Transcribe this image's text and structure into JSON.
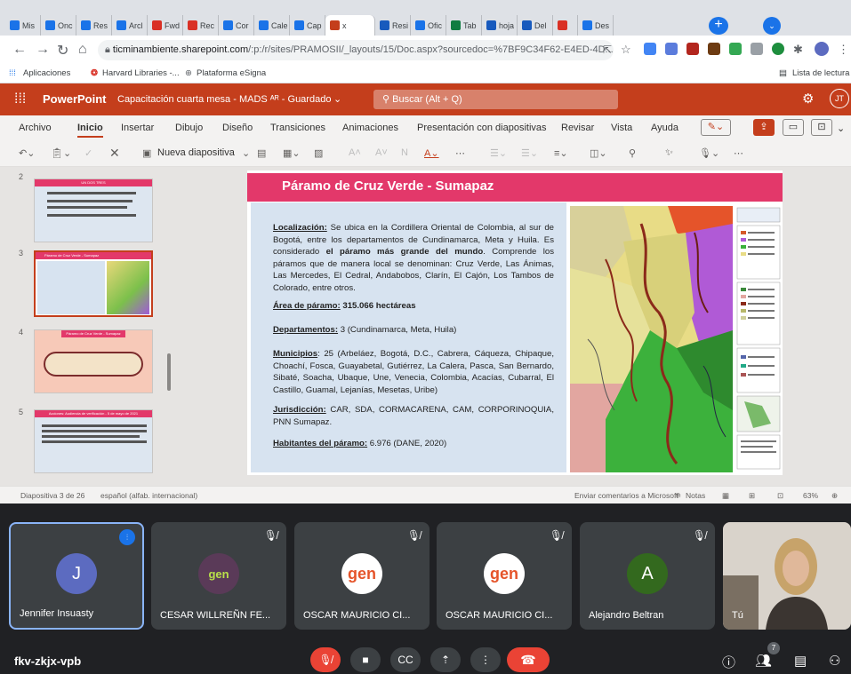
{
  "browser": {
    "tabs": [
      {
        "label": "Mis",
        "icon": "cloud-icon",
        "color": "#1a73e8"
      },
      {
        "label": "Onc",
        "icon": "cloud-icon",
        "color": "#1a73e8"
      },
      {
        "label": "Res",
        "icon": "cloud-icon",
        "color": "#1a73e8"
      },
      {
        "label": "Arcl",
        "icon": "cloud-icon",
        "color": "#1a73e8"
      },
      {
        "label": "Fwd",
        "icon": "gmail-icon",
        "color": "#d93025"
      },
      {
        "label": "Rec",
        "icon": "gmail-icon",
        "color": "#d93025"
      },
      {
        "label": "Cor",
        "icon": "docs-icon",
        "color": "#1a73e8"
      },
      {
        "label": "Cale",
        "icon": "calendar-icon",
        "color": "#1a73e8"
      },
      {
        "label": "Cap",
        "icon": "cloud-icon",
        "color": "#1a73e8"
      },
      {
        "label": "x",
        "icon": "powerpoint-icon",
        "color": "#c43e1c"
      },
      {
        "label": "Resi",
        "icon": "word-icon",
        "color": "#185abd"
      },
      {
        "label": "Ofic",
        "icon": "cloud-icon",
        "color": "#1a73e8"
      },
      {
        "label": "Tab",
        "icon": "excel-icon",
        "color": "#107c41"
      },
      {
        "label": "hoja",
        "icon": "word-icon",
        "color": "#185abd"
      },
      {
        "label": "Del",
        "icon": "word-icon",
        "color": "#185abd"
      },
      {
        "label": "",
        "icon": "record-icon",
        "color": "#d93025"
      },
      {
        "label": "Des",
        "icon": "download-icon",
        "color": "#1a73e8"
      }
    ],
    "new_tab": "+",
    "url_host": "ticminambiente.sharepoint.com",
    "url_path": "/:p:/r/sites/PRAMOSII/_layouts/15/Doc.aspx?sourcedoc=%7BF9C34F62-E4ED-4D...",
    "bookmarks": [
      "Aplicaciones",
      "Harvard Libraries -...",
      "Plataforma eSigna"
    ],
    "reading_list": "Lista de lectura"
  },
  "ppt": {
    "app_name": "PowerPoint",
    "doc_title": "Capacitación cuarta mesa - MADS  ᴬᴿ - Guardado",
    "search_placeholder": "Buscar (Alt + Q)",
    "user_initials": "JT",
    "menu_tabs": [
      "Archivo",
      "Inicio",
      "Insertar",
      "Dibujo",
      "Diseño",
      "Transiciones",
      "Animaciones",
      "Presentación con diapositivas",
      "Revisar",
      "Vista",
      "Ayuda"
    ],
    "active_menu": "Inicio",
    "new_slide": "Nueva diapositiva",
    "thumbnails": [
      {
        "num": "2",
        "title": "UN DOS TRES"
      },
      {
        "num": "3",
        "title": "Páramo de Cruz Verde - Sumapaz"
      },
      {
        "num": "4",
        "title": "Páramo de Cruz Verde - Sumapaz"
      },
      {
        "num": "5",
        "title": "Acciones: Audiencia de verificación - 5 de mayo de 2021"
      }
    ],
    "status": {
      "slide_info": "Diapositiva 3 de 26",
      "language": "español (alfab. internacional)",
      "feedback": "Enviar comentarios a Microsoft",
      "notes": "Notas",
      "zoom": "63%"
    }
  },
  "slide": {
    "title": "Páramo de Cruz Verde - Sumapaz",
    "localizacion_label": "Localización:",
    "localizacion_text_1": " Se ubica en la Cordillera Oriental de Colombia, al sur de Bogotá, entre los departamentos de Cundinamarca, Meta y Huila. Es considerado ",
    "localizacion_bold": "el páramo más grande del mundo",
    "localizacion_text_2": ". Comprende los páramos que de manera local se denominan: Cruz Verde, Las Ánimas, Las Mercedes, El Cedral, Andabobos, Clarín, El Cajón, Los Tambos de Colorado, entre otros.",
    "area_label": "Área de páramo:",
    "area_value": " 315.066 hectáreas",
    "deptos_label": "Departamentos:",
    "deptos_value": " 3 (Cundinamarca, Meta, Huila)",
    "municipios_label": "Municipios",
    "municipios_value": ": 25 (Arbeláez, Bogotá, D.C., Cabrera, Cáqueza, Chipaque, Choachí, Fosca, Guayabetal, Gutiérrez, La Calera, Pasca, San Bernardo, Sibaté, Soacha, Ubaque, Une, Venecia, Colombia, Acacías, Cubarral, El Castillo, Guamal, Lejanías, Mesetas, Uribe)",
    "jurisdiccion_label": "Jurisdicción:",
    "jurisdiccion_value": "     CAR,     SDA,     CORMACARENA,     CAM, CORPORINOQUIA, PNN Sumapaz.",
    "habitantes_label": "Habitantes del páramo:",
    "habitantes_value": " 6.976 (DANE, 2020)"
  },
  "meet": {
    "participants": [
      {
        "name": "Jennifer Insuasty",
        "avatar": "J",
        "avatar_color": "#5c6bc0",
        "speaking": true
      },
      {
        "name": "CESAR WILLREÑN FE...",
        "avatar": "gen",
        "avatar_color": "#ffffff",
        "speaking": false
      },
      {
        "name": "OSCAR MAURICIO CI...",
        "avatar": "gen",
        "avatar_color": "#ffffff",
        "speaking": false
      },
      {
        "name": "OSCAR MAURICIO CI...",
        "avatar": "gen",
        "avatar_color": "#ffffff",
        "speaking": false
      },
      {
        "name": "Alejandro Beltran",
        "avatar": "A",
        "avatar_color": "#33691e",
        "speaking": false
      },
      {
        "name": "Tú",
        "avatar": "",
        "avatar_color": "#cfc7bd",
        "speaking": false
      }
    ],
    "meeting_code": "fkv-zkjx-vpb",
    "people_count": "7"
  }
}
